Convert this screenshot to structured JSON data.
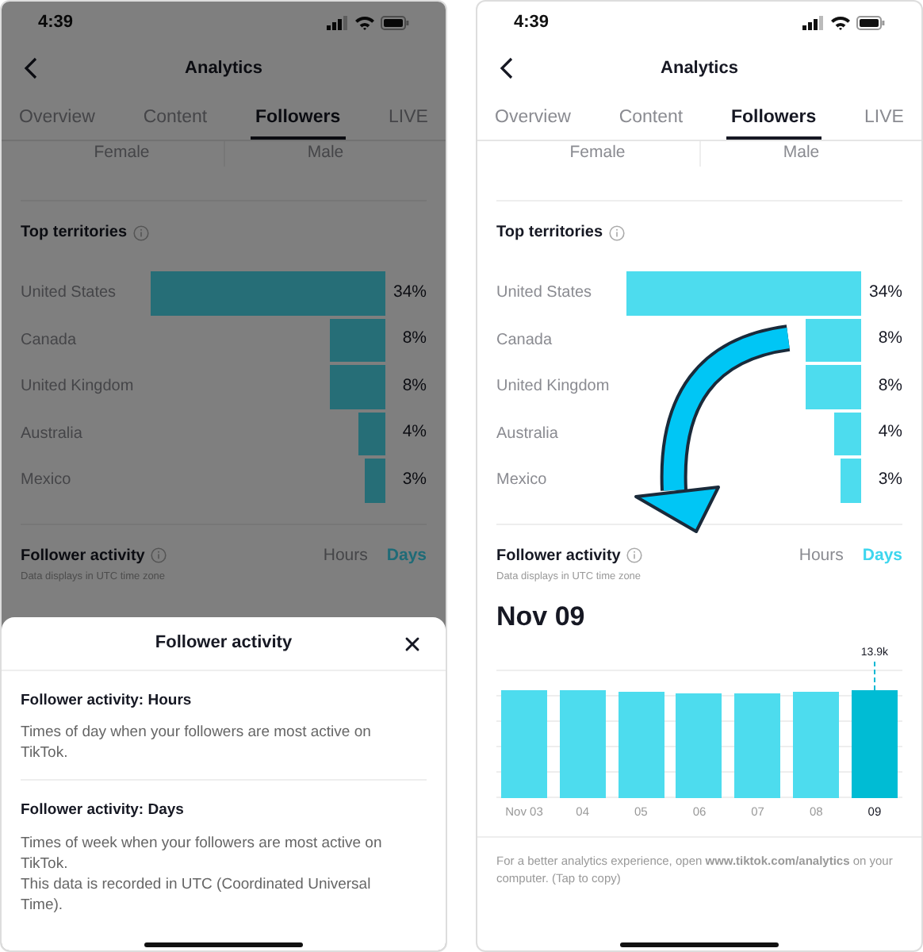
{
  "phones": [
    {
      "dimmed": true,
      "status_time": "4:39",
      "title": "Analytics",
      "tabs": [
        {
          "label": "Overview",
          "selected": false
        },
        {
          "label": "Content",
          "selected": false
        },
        {
          "label": "Followers",
          "selected": true
        },
        {
          "label": "LIVE",
          "selected": false
        }
      ],
      "gender": [
        "Female",
        "Male"
      ],
      "territories": {
        "title": "Top territories",
        "chart_data": {
          "type": "bar",
          "orientation": "horizontal",
          "categories": [
            "United States",
            "Canada",
            "United Kingdom",
            "Australia",
            "Mexico"
          ],
          "values": [
            34,
            8,
            8,
            4,
            3
          ],
          "value_labels": [
            "34%",
            "8%",
            "8%",
            "4%",
            "3%"
          ]
        }
      },
      "activity": {
        "title": "Follower activity",
        "subtitle": "Data displays in UTC time zone",
        "toggles": [
          {
            "label": "Hours",
            "selected": false
          },
          {
            "label": "Days",
            "selected": true
          }
        ]
      },
      "sheet": {
        "title": "Follower activity",
        "sections": [
          {
            "heading": "Follower activity: Hours",
            "lines": [
              "Times of day when your followers are most active on TikTok."
            ]
          },
          {
            "heading": "Follower activity: Days",
            "lines": [
              "Times of week when your followers are most active on TikTok.",
              "This data is recorded in UTC (Coordinated Universal Time)."
            ]
          }
        ]
      }
    },
    {
      "dimmed": false,
      "annotation_arrow": true,
      "status_time": "4:39",
      "title": "Analytics",
      "tabs": [
        {
          "label": "Overview",
          "selected": false
        },
        {
          "label": "Content",
          "selected": false
        },
        {
          "label": "Followers",
          "selected": true
        },
        {
          "label": "LIVE",
          "selected": false
        }
      ],
      "gender": [
        "Female",
        "Male"
      ],
      "territories": {
        "title": "Top territories",
        "chart_data": {
          "type": "bar",
          "orientation": "horizontal",
          "categories": [
            "United States",
            "Canada",
            "United Kingdom",
            "Australia",
            "Mexico"
          ],
          "values": [
            34,
            8,
            8,
            4,
            3
          ],
          "value_labels": [
            "34%",
            "8%",
            "8%",
            "4%",
            "3%"
          ]
        }
      },
      "activity": {
        "title": "Follower activity",
        "subtitle": "Data displays in UTC time zone",
        "toggles": [
          {
            "label": "Hours",
            "selected": false
          },
          {
            "label": "Days",
            "selected": true
          }
        ],
        "date": "Nov 09",
        "peak_label": "13.9k",
        "bars": [
          {
            "label": "Nov 03",
            "selected": false
          },
          {
            "label": "04",
            "selected": false
          },
          {
            "label": "05",
            "selected": false
          },
          {
            "label": "06",
            "selected": false
          },
          {
            "label": "07",
            "selected": false
          },
          {
            "label": "08",
            "selected": false
          },
          {
            "label": "09",
            "selected": true
          }
        ]
      },
      "footer": "For a better analytics experience, open **www.tiktok.com/analytics** on your computer. (Tap to copy)"
    }
  ]
}
